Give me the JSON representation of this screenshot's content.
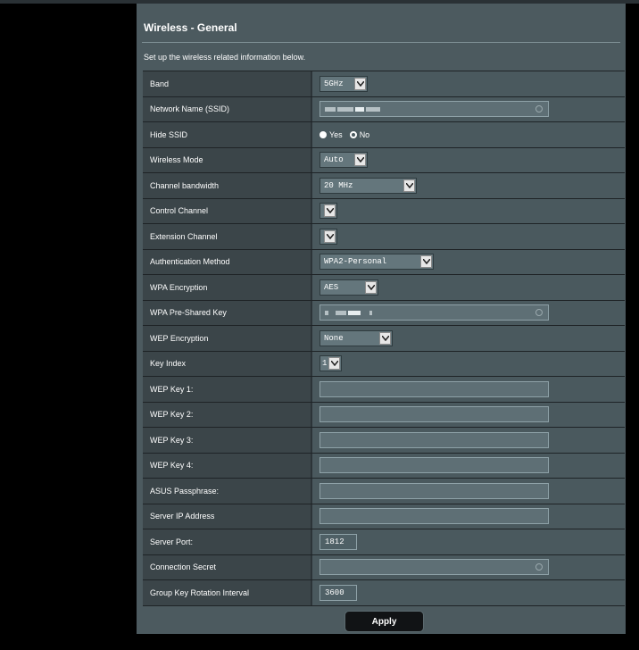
{
  "page": {
    "title": "Wireless - General",
    "subtitle": "Set up the wireless related information below."
  },
  "form": {
    "band": {
      "label": "Band",
      "value": "5GHz"
    },
    "ssid": {
      "label": "Network Name (SSID)"
    },
    "hide_ssid": {
      "label": "Hide SSID",
      "yes": "Yes",
      "no": "No",
      "selected": "Yes"
    },
    "wireless_mode": {
      "label": "Wireless Mode",
      "value": "Auto"
    },
    "channel_bandwidth": {
      "label": "Channel bandwidth",
      "value": "20 MHz"
    },
    "control_channel": {
      "label": "Control Channel",
      "value": ""
    },
    "extension_channel": {
      "label": "Extension Channel",
      "value": ""
    },
    "auth_method": {
      "label": "Authentication Method",
      "value": "WPA2-Personal"
    },
    "wpa_encryption": {
      "label": "WPA Encryption",
      "value": "AES"
    },
    "wpa_psk": {
      "label": "WPA Pre-Shared Key"
    },
    "wep_encryption": {
      "label": "WEP Encryption",
      "value": "None"
    },
    "key_index": {
      "label": "Key Index",
      "value": "1"
    },
    "wep_key1": {
      "label": "WEP Key 1:",
      "value": ""
    },
    "wep_key2": {
      "label": "WEP Key 2:",
      "value": ""
    },
    "wep_key3": {
      "label": "WEP Key 3:",
      "value": ""
    },
    "wep_key4": {
      "label": "WEP Key 4:",
      "value": ""
    },
    "asus_passphrase": {
      "label": "ASUS Passphrase:",
      "value": ""
    },
    "server_ip": {
      "label": "Server IP Address",
      "value": ""
    },
    "server_port": {
      "label": "Server Port:",
      "value": "1812"
    },
    "connection_secret": {
      "label": "Connection Secret",
      "value": ""
    },
    "group_key_interval": {
      "label": "Group Key Rotation Interval",
      "value": "3600"
    }
  },
  "buttons": {
    "apply": "Apply"
  },
  "colors": {
    "panel_bg": "#4c5a5f",
    "label_bg": "#3b4549",
    "value_bg": "#4a595e",
    "page_bg": "#000000"
  }
}
